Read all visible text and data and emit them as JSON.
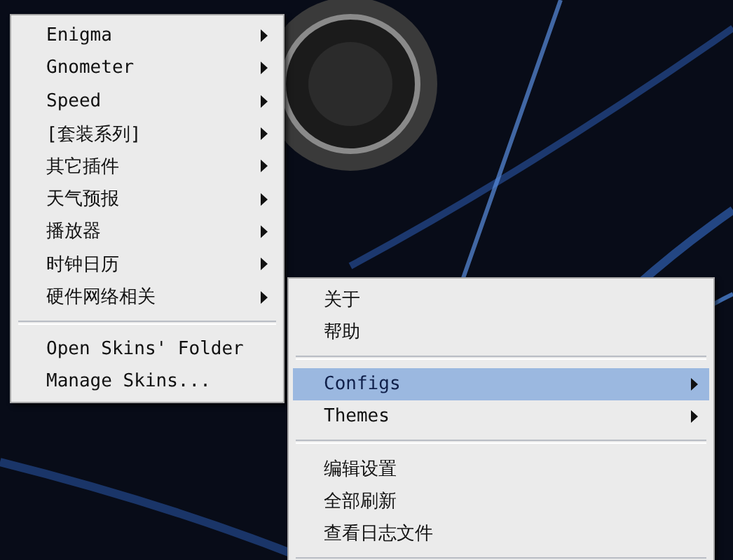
{
  "menus": [
    {
      "items": [
        {
          "kind": "item",
          "label": "Enigma",
          "has_submenu": true,
          "selected": false
        },
        {
          "kind": "item",
          "label": "Gnometer",
          "has_submenu": true,
          "selected": false
        },
        {
          "kind": "item",
          "label": "Speed",
          "has_submenu": true,
          "selected": false
        },
        {
          "kind": "item",
          "label": "[套装系列]",
          "has_submenu": true,
          "selected": false
        },
        {
          "kind": "item",
          "label": "其它插件",
          "has_submenu": true,
          "selected": false
        },
        {
          "kind": "item",
          "label": "天气预报",
          "has_submenu": true,
          "selected": false
        },
        {
          "kind": "item",
          "label": "播放器",
          "has_submenu": true,
          "selected": false
        },
        {
          "kind": "item",
          "label": "时钟日历",
          "has_submenu": true,
          "selected": false
        },
        {
          "kind": "item",
          "label": "硬件网络相关",
          "has_submenu": true,
          "selected": false
        },
        {
          "kind": "separator"
        },
        {
          "kind": "item",
          "label": "Open Skins' Folder",
          "has_submenu": false,
          "selected": false
        },
        {
          "kind": "item",
          "label": "Manage Skins...",
          "has_submenu": false,
          "selected": false
        }
      ]
    },
    {
      "items": [
        {
          "kind": "item",
          "label": "关于",
          "has_submenu": false,
          "selected": false
        },
        {
          "kind": "item",
          "label": "帮助",
          "has_submenu": false,
          "selected": false
        },
        {
          "kind": "separator"
        },
        {
          "kind": "item",
          "label": "Configs",
          "has_submenu": true,
          "selected": true
        },
        {
          "kind": "item",
          "label": "Themes",
          "has_submenu": true,
          "selected": false
        },
        {
          "kind": "separator"
        },
        {
          "kind": "item",
          "label": "编辑设置",
          "has_submenu": false,
          "selected": false
        },
        {
          "kind": "item",
          "label": "全部刷新",
          "has_submenu": false,
          "selected": false
        },
        {
          "kind": "item",
          "label": "查看日志文件",
          "has_submenu": false,
          "selected": false
        },
        {
          "kind": "separator"
        }
      ]
    }
  ]
}
